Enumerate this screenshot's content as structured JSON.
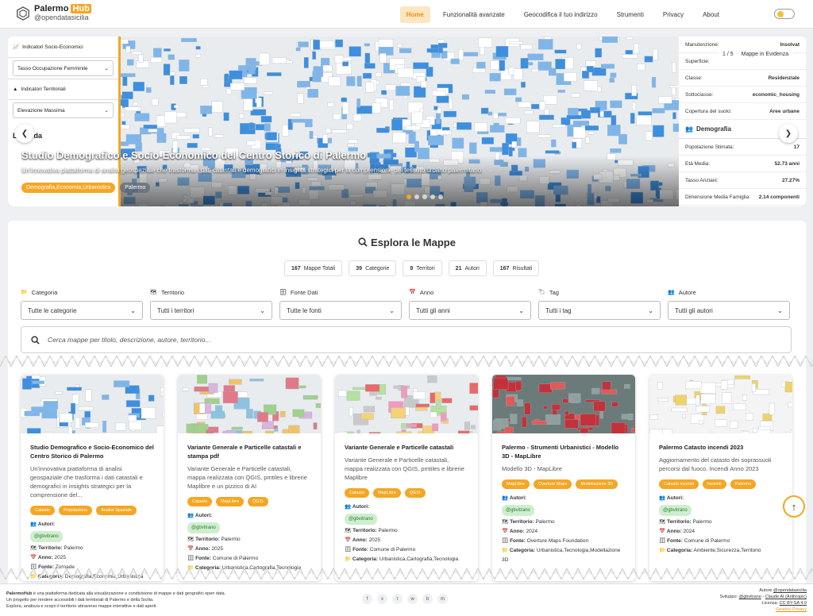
{
  "brand": {
    "name": "Palermo",
    "hub": "Hub",
    "handle": "@opendatasicilia"
  },
  "nav": {
    "items": [
      "Home",
      "Funzionalità avanzate",
      "Geocodifica il tuo indirizzo",
      "Strumenti",
      "Privacy",
      "About"
    ],
    "active": "Home"
  },
  "hero": {
    "counter": "1 / 5",
    "counter_label": "Mappe in Evidenza",
    "title": "Studio Demografico e Socio-Economico del Centro Storico di Palermo",
    "description": "Un'innovativa piattaforma di analisi geospaziale che trasforma i dati catastali e demografici in insights strategici per la comprensione del tessuto urbano palermitano.",
    "tags": [
      "Demografia,Economia,Urbanistica",
      "Palermo"
    ],
    "slide_count": 5,
    "active_slide": 0,
    "left_panel": {
      "items": [
        "Indicatori Socio-Economici",
        "Tasso Occupazione Femminile",
        "Indicatori Territoriali",
        "Elevazione Massima",
        "Legenda"
      ]
    },
    "right_panel": {
      "top_rows": [
        {
          "k": "Manutenzione:",
          "v": "Insolvat"
        },
        {
          "k": "Superficie:",
          "v": ""
        },
        {
          "k": "Classe:",
          "v": "Residenziale"
        },
        {
          "k": "Sottoclasse:",
          "v": "economic_housing"
        },
        {
          "k": "Copertura del suolo:",
          "v": "Aree urbane"
        }
      ],
      "section": "Demografia",
      "demo_rows": [
        {
          "k": "Popolazione Stimata:",
          "v": "17"
        },
        {
          "k": "Età Media:",
          "v": "52.73 anni"
        },
        {
          "k": "Tasso Anziani:",
          "v": "27.27%"
        },
        {
          "k": "Dimensione Media Famiglia:",
          "v": "2.14 componenti"
        }
      ]
    }
  },
  "explore": {
    "title": "Esplora le Mappe",
    "stats": [
      {
        "n": "167",
        "label": "Mappe Totali"
      },
      {
        "n": "39",
        "label": "Categorie"
      },
      {
        "n": "9",
        "label": "Territori"
      },
      {
        "n": "21",
        "label": "Autori"
      },
      {
        "n": "167",
        "label": "Risultati"
      }
    ],
    "filters": [
      {
        "label": "Categoria",
        "value": "Tutte le categorie"
      },
      {
        "label": "Territorio",
        "value": "Tutti i territori"
      },
      {
        "label": "Fonte Dati",
        "value": "Tutte le fonti"
      },
      {
        "label": "Anno",
        "value": "Tutti gli anni"
      },
      {
        "label": "Tag",
        "value": "Tutti i tag"
      },
      {
        "label": "Autore",
        "value": "Tutti gli autori"
      }
    ],
    "search_placeholder": "Cerca mappe per titolo, descrizione, autore, territorio..."
  },
  "labels": {
    "autori": "Autori:",
    "territorio": "Territorio:",
    "anno": "Anno:",
    "fonte": "Fonte:",
    "categoria": "Categoria:"
  },
  "cards": [
    {
      "title": "Studio Demografico e Socio-Economico del Centro Storico di Palermo",
      "description": "Un'innovativa piattaforma di analisi geospaziale che trasforma i dati catastali e demografici in insights strategici per la comprensione del...",
      "tags": [
        "Catasto",
        "Popolazione",
        "Analisi Spaziale"
      ],
      "author": "@gbvitrano",
      "territorio": "Palermo",
      "anno": "2025",
      "fonte": "Zornade",
      "categoria": "Demografia,Economia,Urbanistica"
    },
    {
      "title": "Variante Generale e Particelle catastali e stampa pdf",
      "description": "Variante Generale e Particelle catastali, mappa realizzata con QGIS, pmtiles e librerie Maplibre e un pizzico di AI",
      "tags": [
        "Catasto",
        "MapLibre",
        "QGIS"
      ],
      "author": "@gbvitrano",
      "territorio": "Palermo",
      "anno": "2025",
      "fonte": "Comune di Palermo",
      "categoria": "Urbanistica,Cartografia,Tecnologia"
    },
    {
      "title": "Variante Generale e Particelle catastali",
      "description": "Variante Generale e Particelle catastali, mappa realizzata con QGIS, pmtiles e librerie Maplibre",
      "tags": [
        "Catasto",
        "MapLibre",
        "QGIS"
      ],
      "author": "@gbvitrano",
      "territorio": "Palermo",
      "anno": "2025",
      "fonte": "Comune di Palermo",
      "categoria": "Urbanistica,Cartografia,Tecnologia"
    },
    {
      "title": "Palermo - Strumenti Urbanistici - Modello 3D - MapLibre",
      "description": "Modello 3D - MapLibre",
      "tags": [
        "MapLibre",
        "Overture Maps",
        "Modellazione 3D"
      ],
      "author": "@gbvitrano",
      "territorio": "Palermo",
      "anno": "2024",
      "fonte": "Overture Maps Foundation",
      "categoria": "Urbanistica,Tecnologia,Modellazione 3D"
    },
    {
      "title": "Palermo Catasto incendi 2023",
      "description": "Aggiornamento del catasto dei soprassuoli percorsi dal fuoco. Incendi Anno 2023",
      "tags": [
        "Catasto incendi",
        "Incendi",
        "Palermo"
      ],
      "author": "@gbvitrano",
      "territorio": "Palermo",
      "anno": "2024",
      "fonte": "Comune di Palermo",
      "categoria": "Ambiente,Sicurezza,Territorio"
    }
  ],
  "footer": {
    "line1_brand": "PalermoHub",
    "line1": " è una piattaforma dedicata alla visualizzazione e condivisione di mappe e dati geografici open data.",
    "line2": "Un progetto per rendere accessibili i dati territoriali di Palermo e della Sicilia.",
    "line3": "Esplora, analizza e scopri il territorio attraverso mappe interattive e dati aperti.",
    "author_label": "Autore",
    "author": "@opendatasicilia",
    "dev_label": "Sviluppo:",
    "dev1": "@gbvitrano",
    "dev_sep": " - ",
    "dev2": "Claude AI (Anthropic)",
    "license_label": "Licenza:",
    "license": "CC BY-SA 4.0",
    "privacy": "Gestisci Privacy",
    "social": [
      "f",
      "x",
      "t",
      "w",
      "b",
      "m"
    ]
  },
  "colors": {
    "accent": "#f5a623",
    "map_blue": "#3d8fdf"
  }
}
